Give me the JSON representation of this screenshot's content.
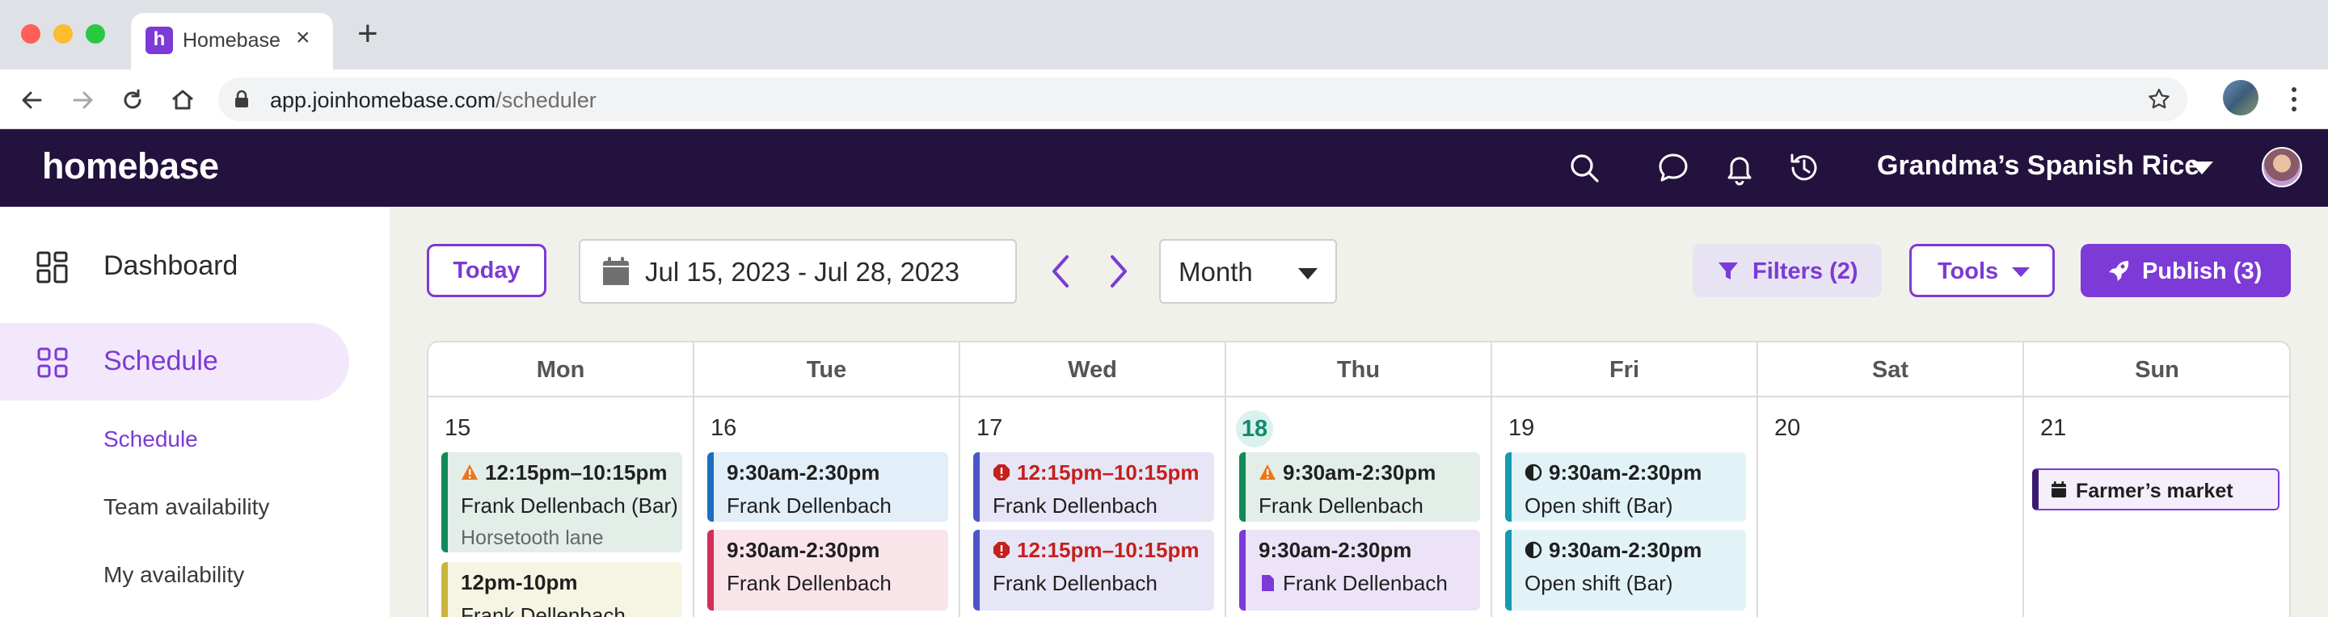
{
  "browser": {
    "tab_title": "Homebase",
    "tab_favicon_letter": "h",
    "url_host": "app.joinhomebase.com",
    "url_path": "/scheduler"
  },
  "header": {
    "logo": "homebase",
    "company": "Grandma’s Spanish Rice"
  },
  "sidebar": {
    "items": [
      {
        "label": "Dashboard",
        "icon": "dashboard-icon"
      },
      {
        "label": "Schedule",
        "icon": "schedule-grid-icon"
      }
    ],
    "sub_items": [
      {
        "label": "Schedule"
      },
      {
        "label": "Team availability"
      },
      {
        "label": "My availability"
      }
    ]
  },
  "toolbar": {
    "today_label": "Today",
    "date_range": "Jul 15, 2023 - Jul 28, 2023",
    "view": "Month",
    "filters_label": "Filters (2)",
    "tools_label": "Tools",
    "publish_label": "Publish (3)"
  },
  "calendar": {
    "days": [
      {
        "name": "Mon",
        "num": "15"
      },
      {
        "name": "Tue",
        "num": "16"
      },
      {
        "name": "Wed",
        "num": "17"
      },
      {
        "name": "Thu",
        "num": "18"
      },
      {
        "name": "Fri",
        "num": "19"
      },
      {
        "name": "Sat",
        "num": "20"
      },
      {
        "name": "Sun",
        "num": "21"
      }
    ],
    "shifts": {
      "mon_1": {
        "time": "12:15pm–10:15pm",
        "name": "Frank Dellenbach (Bar)",
        "loc": "Horsetooth lane"
      },
      "mon_2": {
        "time": "12pm-10pm",
        "name": "Frank Dellenbach"
      },
      "tue_1": {
        "time": "9:30am-2:30pm",
        "name": "Frank Dellenbach"
      },
      "tue_2": {
        "time": "9:30am-2:30pm",
        "name": "Frank Dellenbach"
      },
      "wed_1": {
        "time": "12:15pm–10:15pm",
        "name": "Frank Dellenbach"
      },
      "wed_2": {
        "time": "12:15pm–10:15pm",
        "name": "Frank Dellenbach"
      },
      "thu_1": {
        "time": "9:30am-2:30pm",
        "name": "Frank Dellenbach"
      },
      "thu_2": {
        "time": "9:30am-2:30pm",
        "name": "Frank Dellenbach"
      },
      "fri_1": {
        "time": "9:30am-2:30pm",
        "name": "Open shift (Bar)"
      },
      "fri_2": {
        "time": "9:30am-2:30pm",
        "name": "Open shift (Bar)"
      }
    },
    "event": {
      "label": "Farmer’s market"
    }
  },
  "colors": {
    "brand_purple": "#7c3ad6",
    "header_bg": "#23113e",
    "alert_red": "#c4201c",
    "warning_orange": "#e8771f"
  }
}
